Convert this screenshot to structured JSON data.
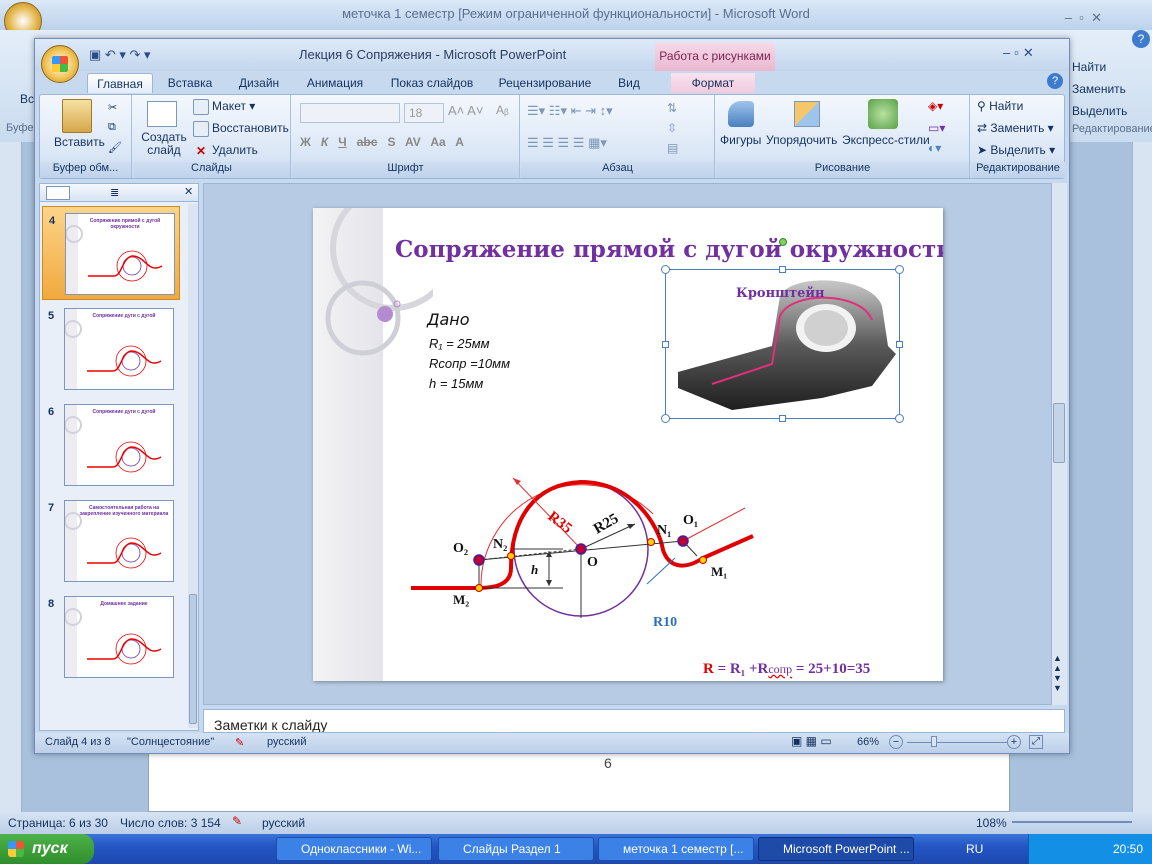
{
  "word": {
    "title": "меточка 1 семестр [Режим ограниченной функциональности] - Microsoft Word",
    "right_ribbon": [
      "Найти",
      "Заменить",
      "Выделить",
      "Редактирование"
    ],
    "partial_left": [
      "Вст",
      "Буфе"
    ],
    "page_number_text": "6",
    "status": {
      "page": "Страница: 6 из 30",
      "words": "Число слов: 3 154",
      "lang": "русский",
      "zoom": "108%"
    }
  },
  "taskbar": {
    "start_label": "пуск",
    "items": [
      "Одноклассники - Wi...",
      "Слайды Раздел 1",
      "меточка 1 семестр [...",
      "Microsoft PowerPoint ..."
    ],
    "lang": "RU",
    "clock": "20:50"
  },
  "ppt": {
    "title": "Лекция 6 Сопряжения - Microsoft PowerPoint",
    "context_tab_group": "Работа с рисунками",
    "tabs": [
      "Главная",
      "Вставка",
      "Дизайн",
      "Анимация",
      "Показ слайдов",
      "Рецензирование",
      "Вид",
      "Формат"
    ],
    "ribbon": {
      "clipboard": {
        "paste": "Вставить",
        "label": "Буфер обм..."
      },
      "slides": {
        "new_slide": "Создать слайд",
        "layout": "Макет",
        "reset": "Восстановить",
        "delete": "Удалить",
        "label": "Слайды"
      },
      "font": {
        "font_name": "",
        "font_size": "18",
        "label": "Шрифт",
        "bold": "Ж",
        "italic": "К",
        "underline": "Ч",
        "strike": "abc",
        "shadow": "S",
        "spacing": "AV",
        "case": "Aa",
        "color": "A"
      },
      "paragraph": {
        "label": "Абзац"
      },
      "drawing": {
        "shapes": "Фигуры",
        "arrange": "Упорядочить",
        "quick_styles": "Экспресс-стили",
        "label": "Рисование"
      },
      "editing": {
        "find": "Найти",
        "replace": "Заменить",
        "select": "Выделить",
        "label": "Редактирование"
      }
    },
    "thumbnails": [
      {
        "num": "4",
        "title": "Сопряжение прямой с дугой окружности",
        "active": true
      },
      {
        "num": "5",
        "title": "Сопряжение дуги с дугой",
        "active": false
      },
      {
        "num": "6",
        "title": "Сопряжение дуги с дугой",
        "active": false
      },
      {
        "num": "7",
        "title": "Самостоятельная работа на закрепление изученного материала",
        "active": false
      },
      {
        "num": "8",
        "title": "Домашнее задание",
        "active": false
      }
    ],
    "slide": {
      "title": "Сопряжение прямой с дугой окружности",
      "image_caption": "Кронштейн",
      "given": {
        "heading": "Дано",
        "lines": [
          "R₁ =  25мм",
          "Rсопр =10мм",
          "h  =  15мм"
        ]
      },
      "diagram_labels": {
        "r35": "R35",
        "r25": "R25",
        "r10": "R10",
        "o": "O",
        "o1": "O₁",
        "o2": "O₂",
        "n1": "N₁",
        "n2": "N₂",
        "m1": "M₁",
        "m2": "M₂",
        "h": "h"
      },
      "formula": {
        "r": "R",
        "rest": "= R₁ +R",
        "sub": "сопр",
        "tail": " = 25+10=35"
      },
      "page": "4"
    },
    "notes_placeholder": "Заметки к слайду",
    "status": {
      "slide": "Слайд 4 из 8",
      "theme": "\"Солнцестояние\"",
      "lang": "русский",
      "zoom": "66%"
    }
  }
}
